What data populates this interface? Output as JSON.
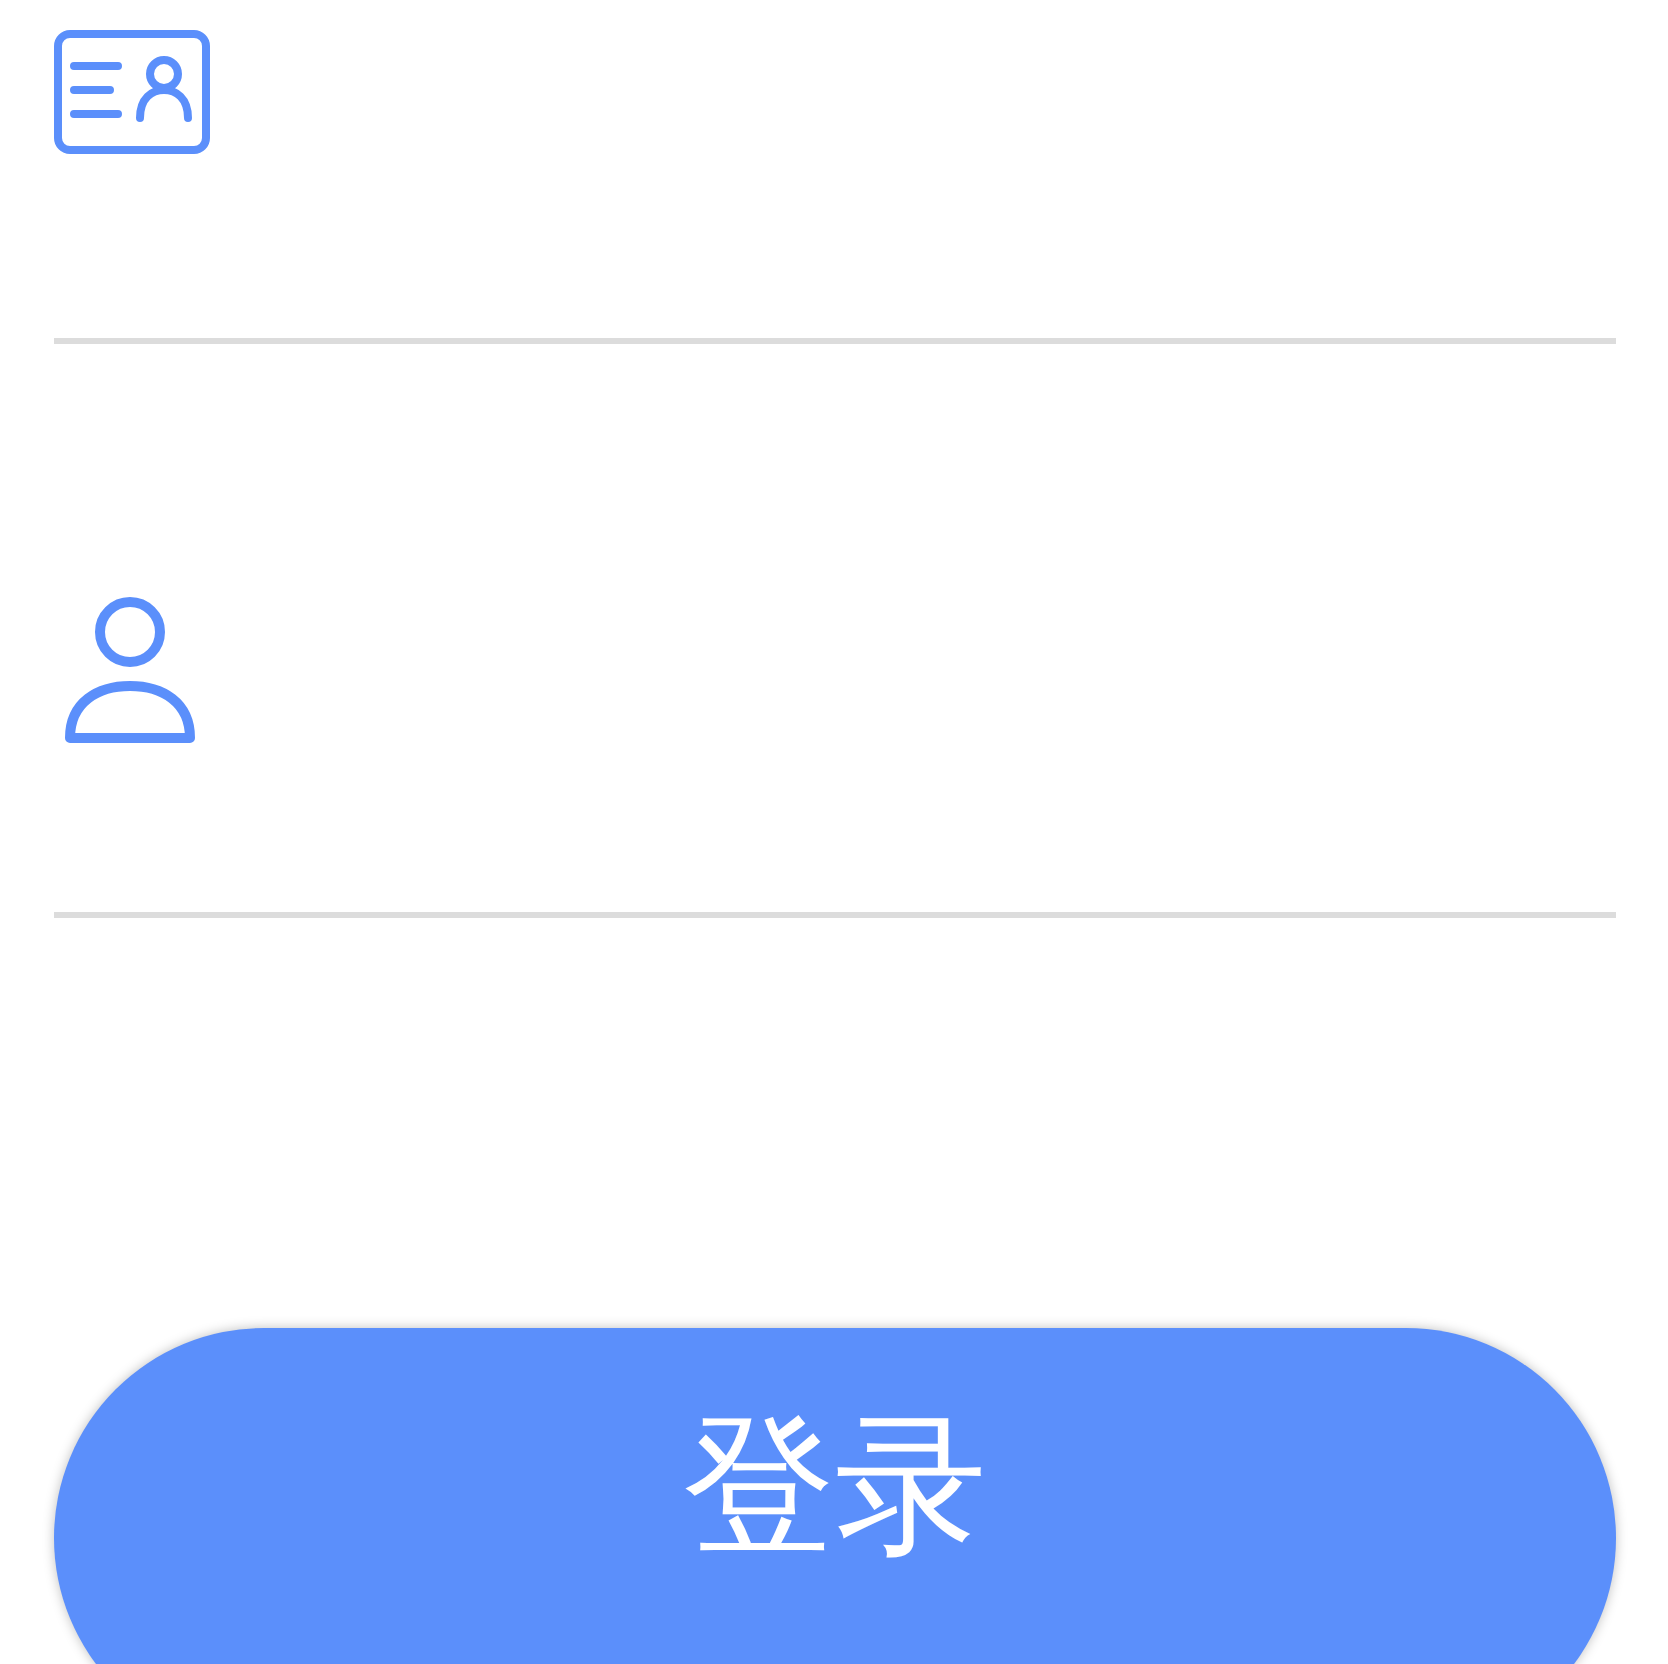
{
  "fields": [
    {
      "kind": "card"
    },
    {
      "kind": "person"
    }
  ],
  "login_button": {
    "label": "登录"
  }
}
